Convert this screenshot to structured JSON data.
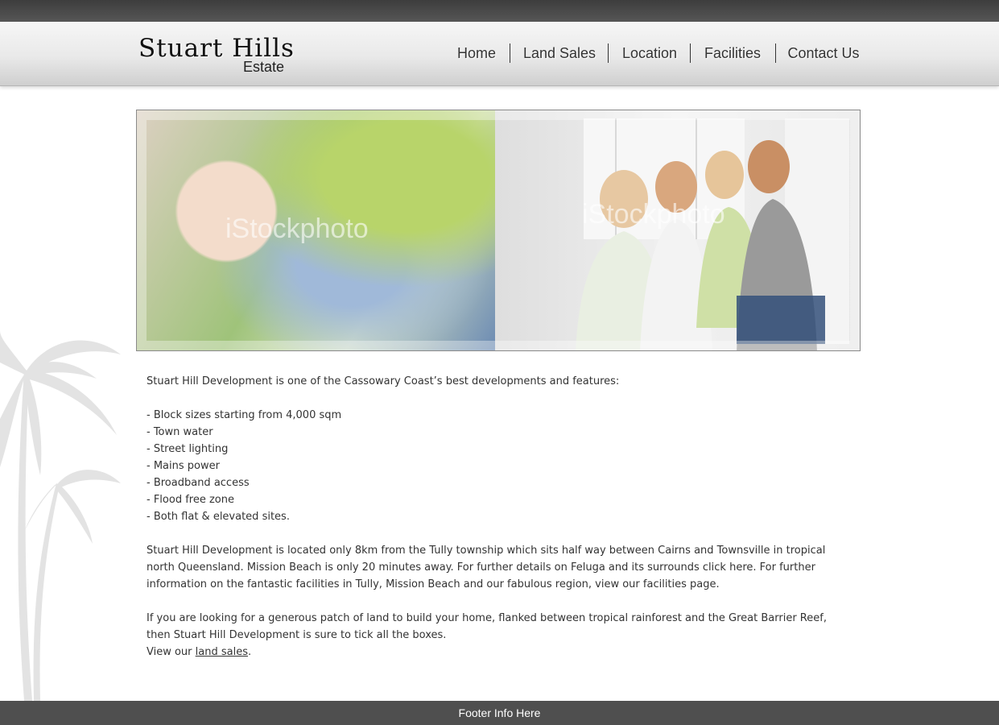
{
  "header": {
    "logo_main": "Stuart Hills",
    "logo_sub": "Estate",
    "nav": [
      "Home",
      "Land Sales",
      "Location",
      "Facilities",
      "Contact Us"
    ]
  },
  "hero": {
    "watermark_left": "iStockphoto",
    "watermark_right": "iStockphoto"
  },
  "content": {
    "intro": "Stuart Hill Development  is one of the Cassowary Coast’s best developments and features:",
    "features": [
      "- Block sizes starting from 4,000 sqm",
      "- Town water",
      "- Street lighting",
      "- Mains power",
      "- Broadband access",
      "- Flood free zone",
      "- Both flat & elevated sites."
    ],
    "location_p": "Stuart Hill Development is located only 8km from the Tully township which sits half way between Cairns and Townsville in tropical north Queensland.  Mission Beach is only 20 minutes away. For further details on Feluga and its surrounds click here.  For further information on the fantastic facilities in Tully, Mission Beach and our fabulous region, view our facilities page.",
    "closing_p": "If you are looking for a generous patch of land to build your home, flanked between tropical rainforest and the Great Barrier Reef, then Stuart Hill Development is sure to tick all the boxes.",
    "view_prefix": "View our ",
    "view_link": "land sales",
    "view_suffix": "."
  },
  "footer": {
    "text": "Footer Info Here"
  },
  "colors": {
    "topbar": "#4a4a4a",
    "footer": "#4f4f4f",
    "text": "#333333"
  }
}
